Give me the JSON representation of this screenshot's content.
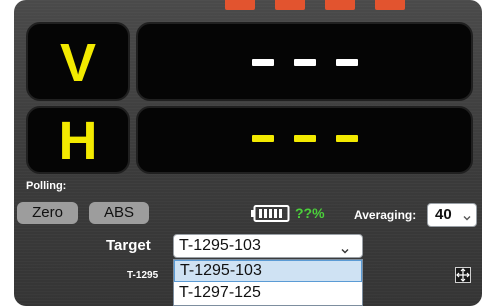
{
  "display": {
    "v_label": "V",
    "h_label": "H",
    "v_value": "- - -",
    "h_value": "- - -",
    "v_color": "#ffffff",
    "h_color": "#f3ea00"
  },
  "controls": {
    "polling_label": "Polling:",
    "zero_button": "Zero",
    "abs_button": "ABS",
    "battery_percent": "??%",
    "battery_color": "#4bd03a",
    "averaging_label": "Averaging:",
    "averaging_value": "40"
  },
  "target": {
    "label": "Target",
    "selected": "T-1295-103",
    "secondary_label": "T-1295",
    "options": [
      "T-1295-103",
      "T-1297-125"
    ]
  },
  "icons": {
    "chevron": "chevron-down-icon",
    "fullscreen": "fullscreen-icon",
    "battery": "battery-icon"
  }
}
